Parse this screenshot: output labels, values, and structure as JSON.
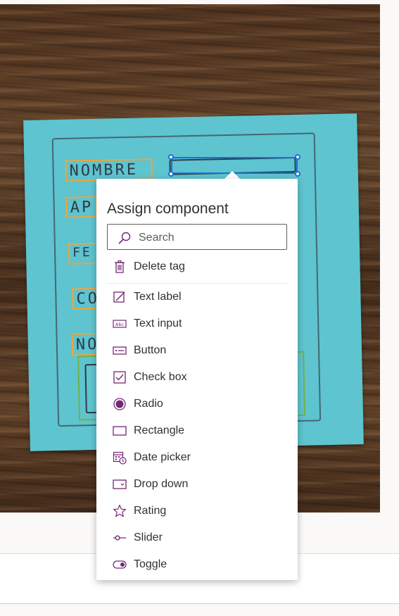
{
  "popup": {
    "title": "Assign component",
    "search_placeholder": "Search",
    "delete_label": "Delete tag",
    "items": [
      {
        "label": "Text label",
        "icon": "text-label-icon"
      },
      {
        "label": "Text input",
        "icon": "text-input-icon"
      },
      {
        "label": "Button",
        "icon": "button-icon"
      },
      {
        "label": "Check box",
        "icon": "checkbox-icon"
      },
      {
        "label": "Radio",
        "icon": "radio-icon"
      },
      {
        "label": "Rectangle",
        "icon": "rectangle-icon"
      },
      {
        "label": "Date picker",
        "icon": "date-picker-icon"
      },
      {
        "label": "Drop down",
        "icon": "drop-down-icon"
      },
      {
        "label": "Rating",
        "icon": "rating-icon"
      },
      {
        "label": "Slider",
        "icon": "slider-icon"
      },
      {
        "label": "Toggle",
        "icon": "toggle-icon"
      }
    ]
  },
  "sketch": {
    "handwritten": [
      "NOMBRE",
      "AP",
      "FE",
      "CO",
      "NO"
    ]
  },
  "colors": {
    "accent": "#742774",
    "selection": "#1c6fd8",
    "tag_box": "#f2a33a",
    "sticky_note": "#5ec4cf"
  }
}
